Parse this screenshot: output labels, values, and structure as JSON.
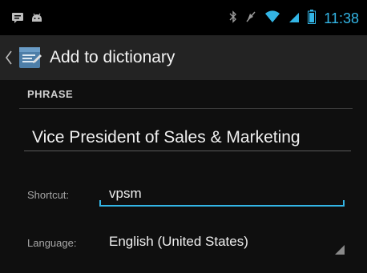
{
  "status_bar": {
    "time": "11:38",
    "icons": [
      "message-icon",
      "android-debug-icon",
      "bluetooth-icon",
      "mute-icon",
      "wifi-icon",
      "signal-icon",
      "battery-icon"
    ]
  },
  "action_bar": {
    "title": "Add to dictionary",
    "icon": "dictionary-icon",
    "up_icon": "chevron-left-icon"
  },
  "phrase_section": {
    "header": "PHRASE",
    "value": "Vice President of Sales & Marketing"
  },
  "shortcut": {
    "label": "Shortcut:",
    "value": "vpsm"
  },
  "language": {
    "label": "Language:",
    "selected": "English (United States)"
  },
  "colors": {
    "accent": "#33b5e5",
    "action_bar_bg": "#232323",
    "content_bg": "#0f0f0f"
  }
}
